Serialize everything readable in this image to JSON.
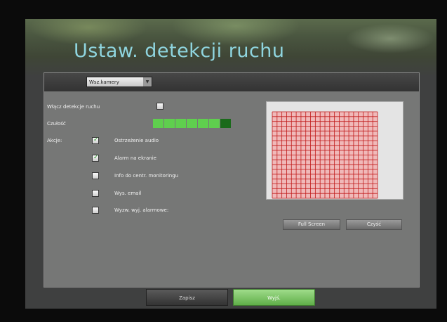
{
  "title": "Ustaw. detekcji ruchu",
  "camera_select": {
    "value": "Wsz.kamery"
  },
  "motion_detect": {
    "label": "Włącz detekcje ruchu",
    "checked": false
  },
  "sensitivity": {
    "label": "Czułość",
    "level": 0.857,
    "segments_total": 7,
    "segments_on": 6
  },
  "actions": {
    "label": "Akcje:",
    "items": [
      {
        "label": "Ostrzeżenie audio",
        "checked": true
      },
      {
        "label": "Alarm na ekranie",
        "checked": true
      },
      {
        "label": "Info do centr. monitoringu",
        "checked": false
      },
      {
        "label": "Wys. email",
        "checked": false
      },
      {
        "label": "Wyzw. wyj. alarmowe:",
        "checked": false
      }
    ]
  },
  "buttons": {
    "full_screen": "Full Screen",
    "clear": "Czyść",
    "save": "Zapisz",
    "exit": "Wyjś."
  },
  "colors": {
    "title": "#8fd5df",
    "grid": "#c01a1a",
    "active_segment": "#5fcf4e",
    "exit_button": "#7cc564"
  }
}
